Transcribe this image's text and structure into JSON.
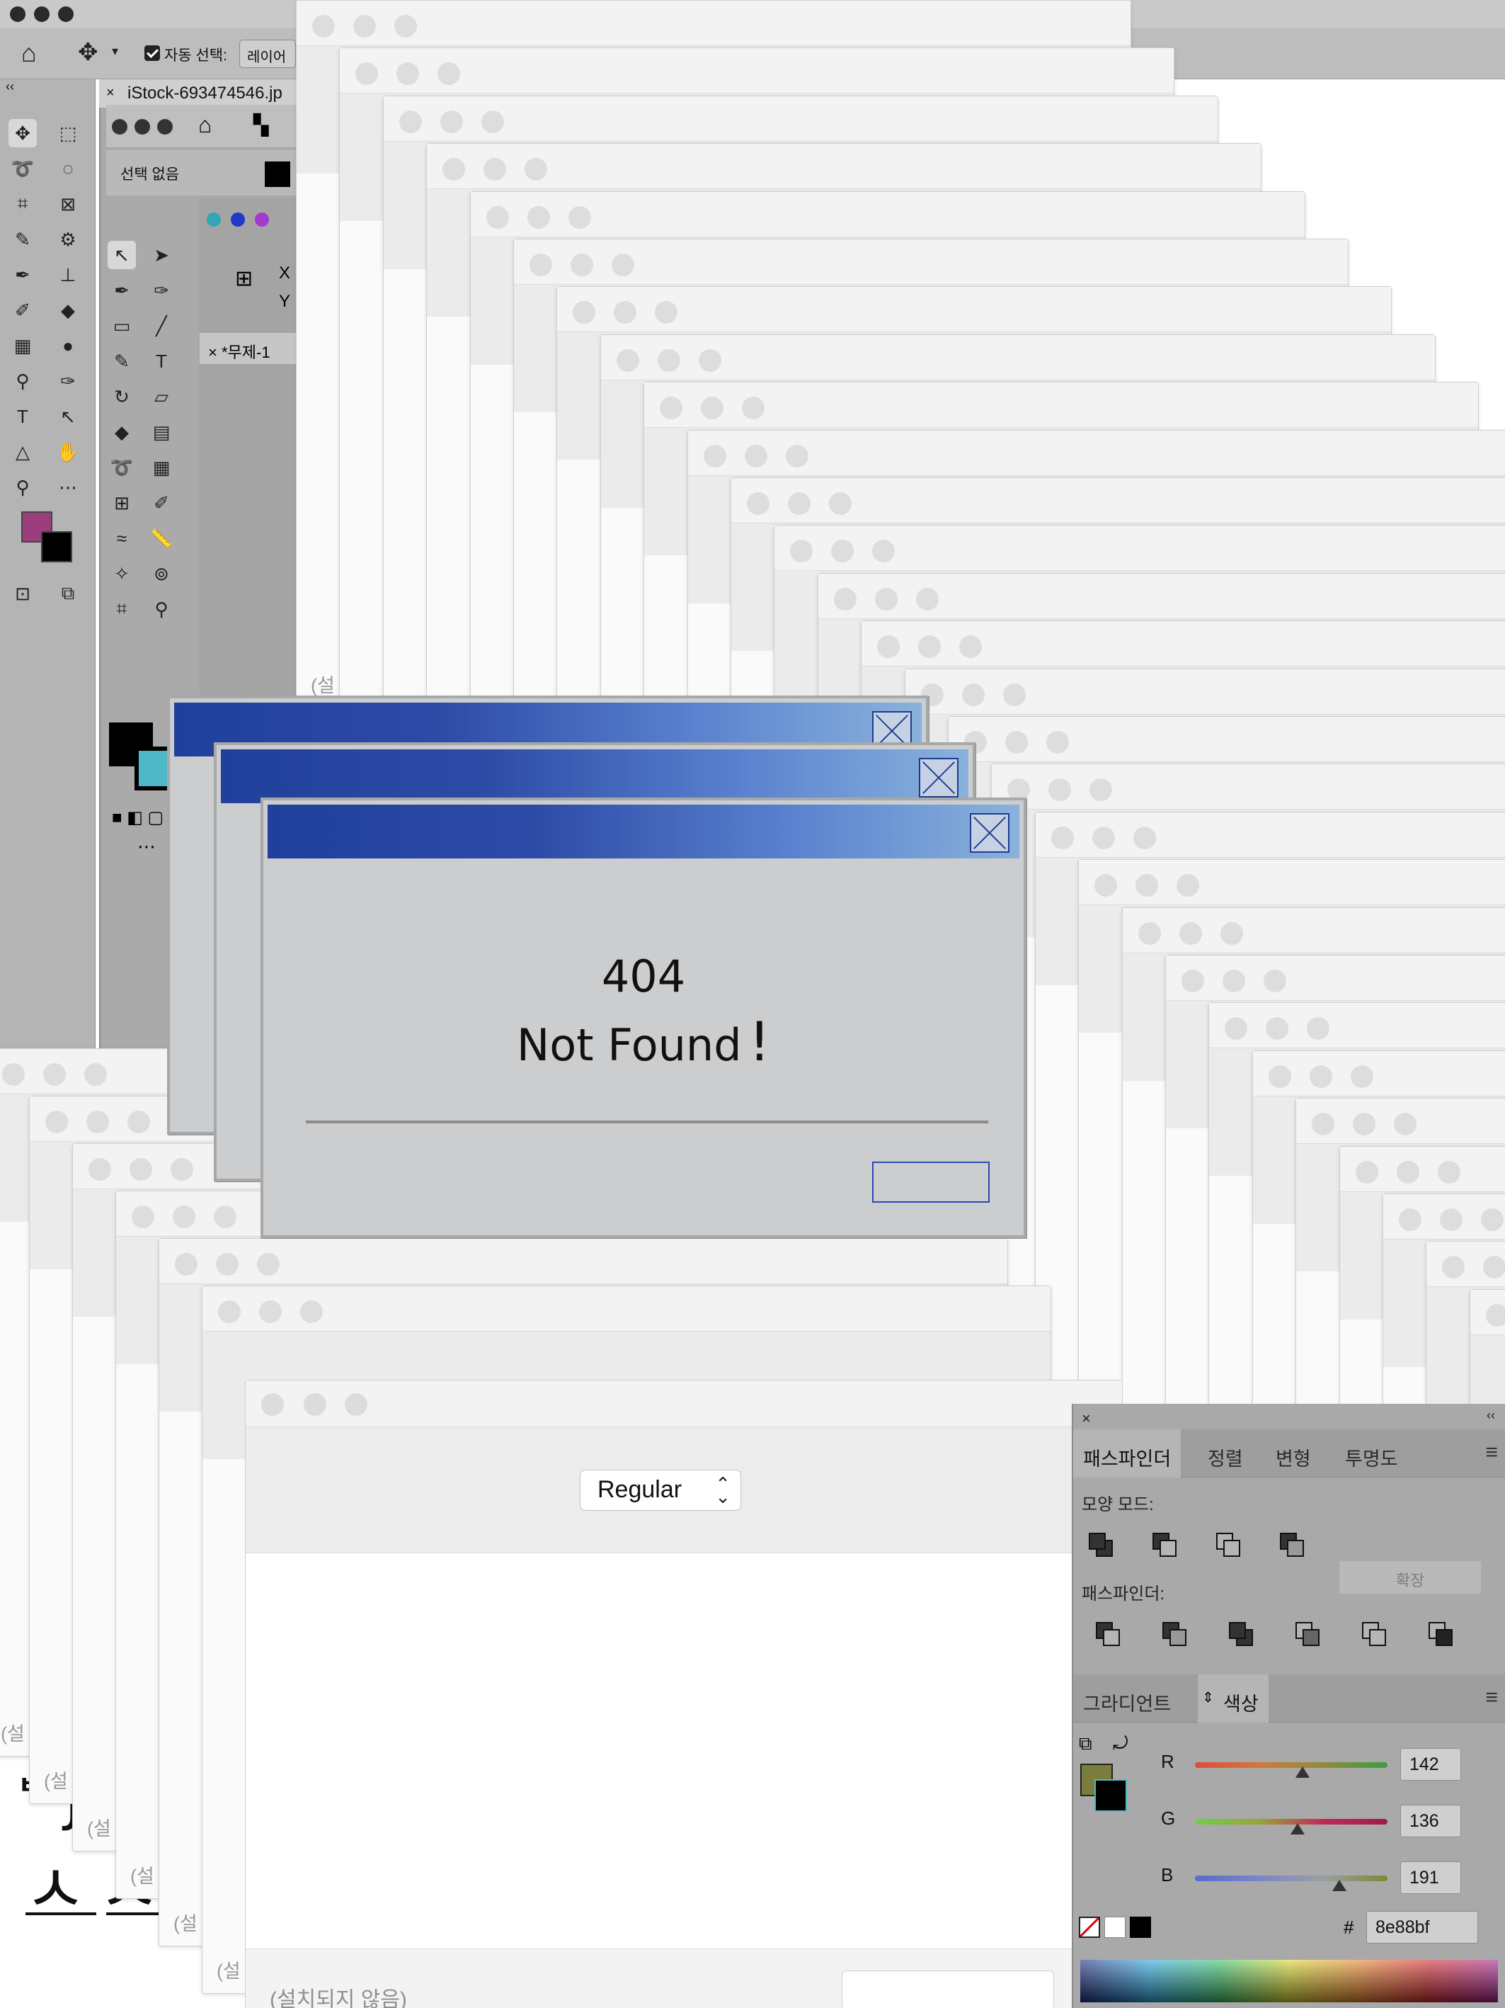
{
  "photoshop": {
    "option_bar": {
      "auto_select_label": "자동 선택:",
      "layer_value": "레이어"
    },
    "document_tab": "iStock-693474546.jp"
  },
  "illustrator": {
    "selection_label": "선택 없음",
    "document_tab": "*무제-1",
    "transform_x": "X",
    "transform_y": "Y"
  },
  "stacked_windows": {
    "footer_label": "(설"
  },
  "error_dialog": {
    "code": "404",
    "message": "Not Found",
    "exclamation": "!"
  },
  "font_window": {
    "style_select_value": "Regular",
    "footer_label": "(설치되지 않음)"
  },
  "pathfinder_panel": {
    "tabs": [
      "패스파인더",
      "정렬",
      "변형",
      "투명도"
    ],
    "shape_modes_label": "모양 모드:",
    "expand_button": "확장",
    "pathfinders_label": "패스파인더:"
  },
  "color_panel": {
    "tabs": [
      "그라디언트",
      "색상"
    ],
    "channels": [
      {
        "name": "R",
        "value": "142",
        "fraction": 0.557
      },
      {
        "name": "G",
        "value": "136",
        "fraction": 0.533
      },
      {
        "name": "B",
        "value": "191",
        "fraction": 0.749
      }
    ],
    "hash_label": "#",
    "hex_value": "8e88bf"
  },
  "lettering": {
    "top_glyph": "ᄬJ",
    "bottom_glyphs": "ㅅㅅ"
  },
  "colors": {
    "dialog_title_start": "#20409c",
    "dialog_title_end": "#8ab2dc",
    "dialog_body": "#cbcdcf",
    "fill_swatch": "#7a7d3e",
    "ps_foreground": "#9c3e7c"
  }
}
